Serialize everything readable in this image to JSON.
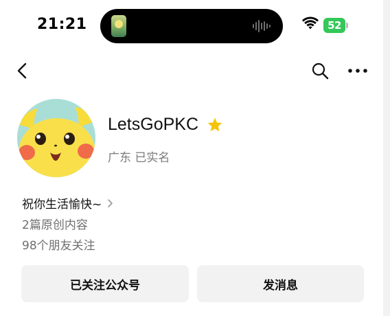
{
  "status_bar": {
    "time": "21:21",
    "battery": "52"
  },
  "nav": {
    "back_icon": "chevron-left-icon",
    "search_icon": "search-icon",
    "more_icon": "more-dots-icon"
  },
  "profile": {
    "name": "LetsGoPKC",
    "badge_icon": "star-icon",
    "location": "广东 已实名",
    "signature": "祝你生活愉快~",
    "original_count": "2篇原创内容",
    "friends_following": "98个朋友关注"
  },
  "actions": {
    "follow_label": "已关注公众号",
    "message_label": "发消息"
  },
  "colors": {
    "battery": "#34c759",
    "star": "#f5c400",
    "avatar_bg": "#a9ded7",
    "button_bg": "#f2f2f2"
  }
}
